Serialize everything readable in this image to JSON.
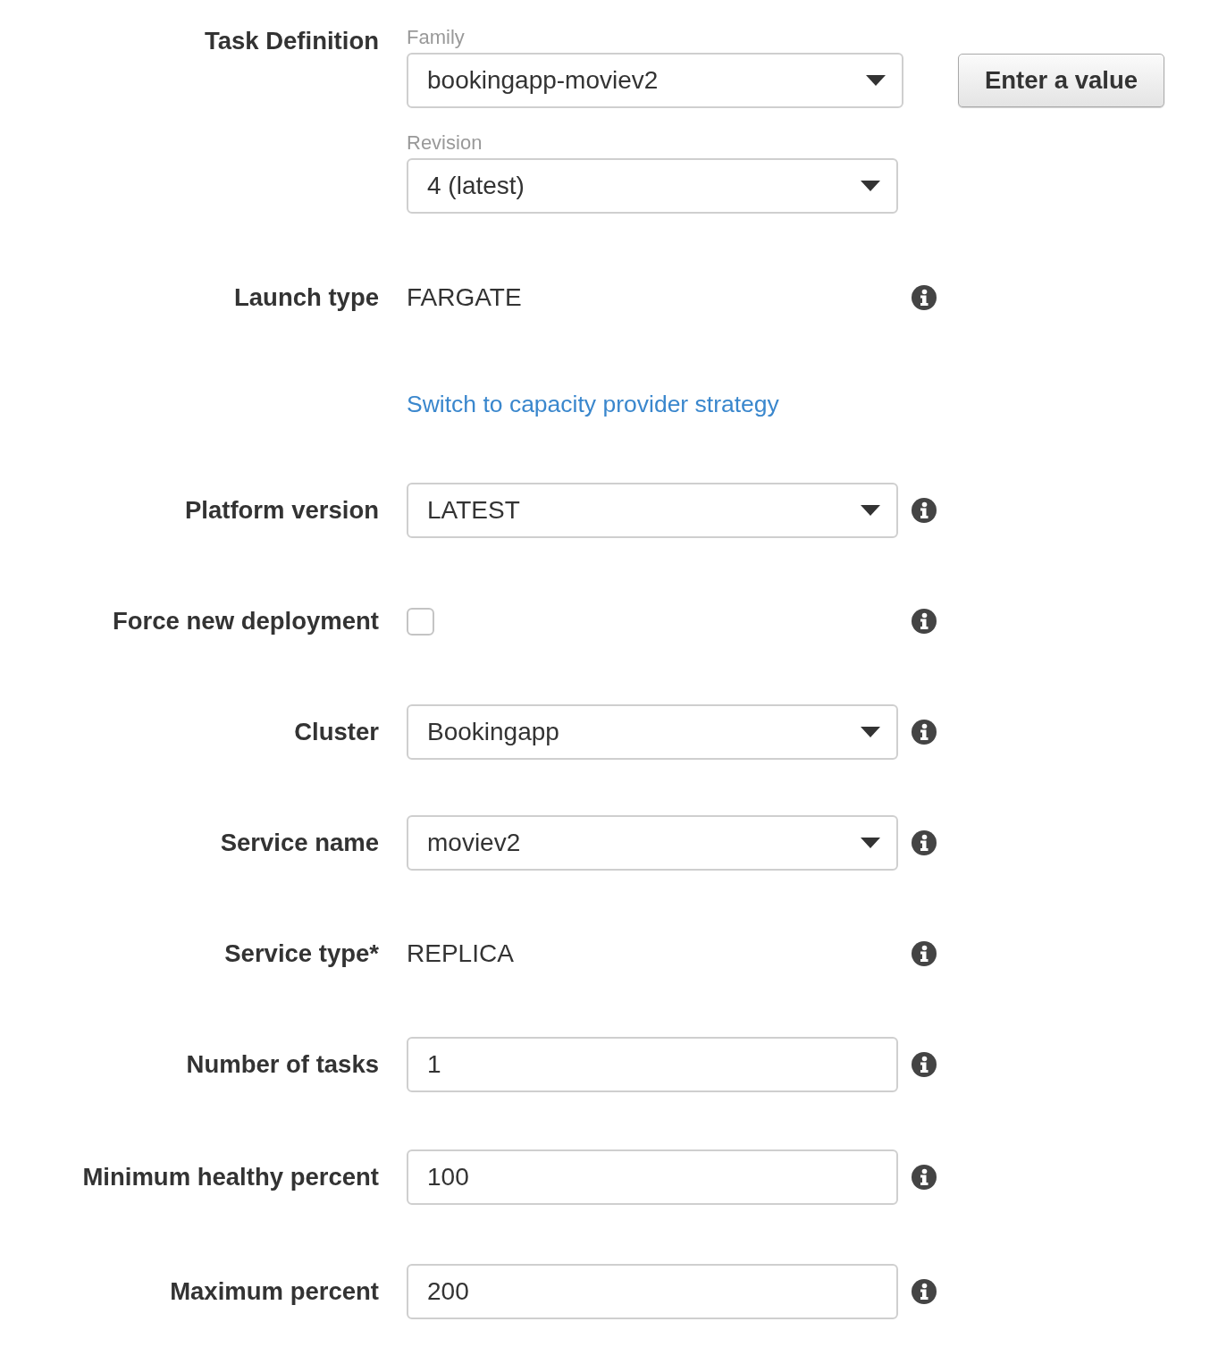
{
  "task_definition": {
    "label": "Task Definition",
    "family": {
      "label": "Family",
      "value": "bookingapp-moviev2"
    },
    "revision": {
      "label": "Revision",
      "value": "4 (latest)"
    },
    "button": "Enter a value"
  },
  "fields": [
    {
      "kind": "text",
      "label": "Launch type",
      "value": "FARGATE"
    },
    {
      "kind": "link",
      "text": "Switch to capacity provider strategy"
    },
    {
      "kind": "select",
      "label": "Platform version",
      "value": "LATEST"
    },
    {
      "kind": "checkbox",
      "label": "Force new deployment",
      "checked": false
    },
    {
      "kind": "select",
      "label": "Cluster",
      "value": "Bookingapp"
    },
    {
      "kind": "select",
      "label": "Service name",
      "value": "moviev2"
    },
    {
      "kind": "text",
      "label": "Service type*",
      "value": "REPLICA"
    },
    {
      "kind": "input",
      "label": "Number of tasks",
      "value": "1"
    },
    {
      "kind": "input",
      "label": "Minimum healthy percent",
      "value": "100"
    },
    {
      "kind": "input",
      "label": "Maximum percent",
      "value": "200"
    }
  ]
}
